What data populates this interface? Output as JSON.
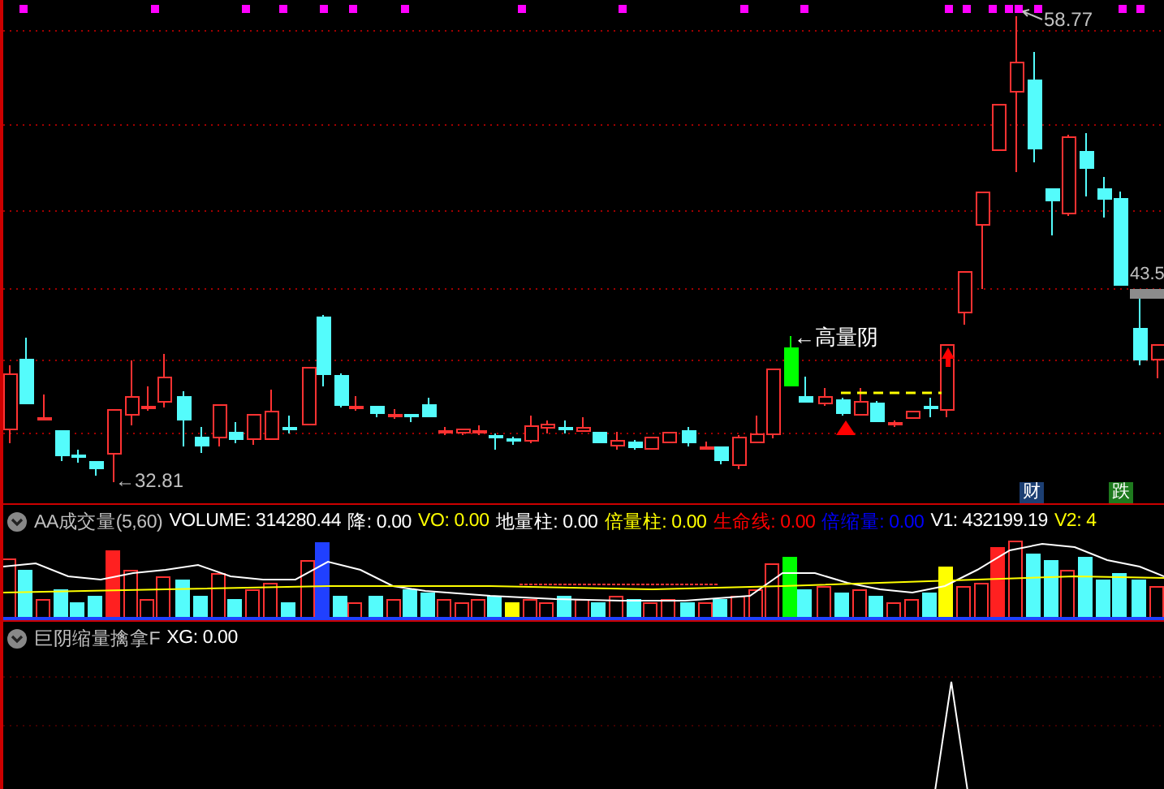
{
  "price_panel": {
    "high_label": "58.77",
    "low_label": "←32.81",
    "last_price_label": "43.5",
    "annotation": "←高量阴",
    "badges": [
      {
        "text": "财",
        "color": "#1c3f73"
      },
      {
        "text": "跌",
        "color": "#1e7a1e"
      }
    ]
  },
  "volume_panel": {
    "title": "AA成交量(5,60)",
    "legend": [
      {
        "text": "VOLUME: 314280.44",
        "color": "#ffffff"
      },
      {
        "text": "降: 0.00",
        "color": "#ffffff"
      },
      {
        "text": "VO: 0.00",
        "color": "#ffff00"
      },
      {
        "text": "地量柱: 0.00",
        "color": "#ffffff"
      },
      {
        "text": "倍量柱: 0.00",
        "color": "#ffff00"
      },
      {
        "text": "生命线: 0.00",
        "color": "#ff0000"
      },
      {
        "text": "倍缩量: 0.00",
        "color": "#0000ff"
      },
      {
        "text": "V1: 432199.19",
        "color": "#ffffff"
      },
      {
        "text": "V2: 4",
        "color": "#ffff00"
      }
    ]
  },
  "signal_panel": {
    "title": "巨阴缩量擒拿F",
    "legend": [
      {
        "text": "XG: 0.00",
        "color": "#ffffff"
      }
    ]
  }
}
